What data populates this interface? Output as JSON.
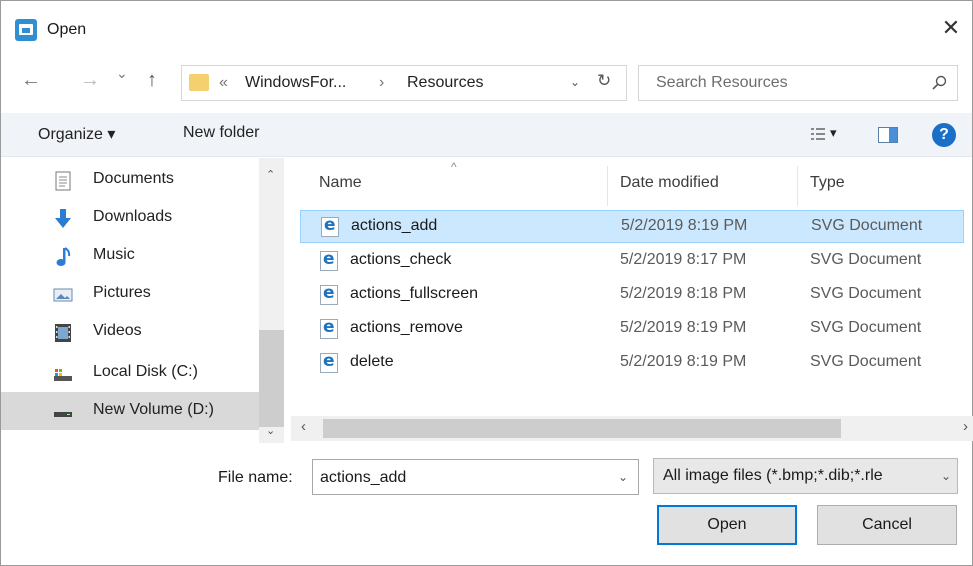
{
  "window": {
    "title": "Open",
    "close_glyph": "✕"
  },
  "nav": {
    "back": "←",
    "forward": "→",
    "recent": "⌄",
    "up": "↑"
  },
  "address": {
    "overflow": "«",
    "crumbs": [
      "WindowsFor...",
      "Resources"
    ],
    "separator": "›",
    "dropdown": "⌄",
    "refresh": "↻"
  },
  "search": {
    "placeholder": "Search Resources"
  },
  "toolbar": {
    "organize": "Organize ▾",
    "new_folder": "New folder",
    "view_chevron": "▾",
    "help": "?"
  },
  "sidebar": {
    "items": [
      {
        "label": "Documents",
        "icon": "documents-icon"
      },
      {
        "label": "Downloads",
        "icon": "downloads-icon"
      },
      {
        "label": "Music",
        "icon": "music-icon"
      },
      {
        "label": "Pictures",
        "icon": "pictures-icon"
      },
      {
        "label": "Videos",
        "icon": "videos-icon"
      },
      {
        "label": "Local Disk (C:)",
        "icon": "local-disk-icon"
      },
      {
        "label": "New Volume (D:)",
        "icon": "drive-icon",
        "selected": true
      }
    ],
    "scroll_up": "⌃",
    "scroll_down": "⌄"
  },
  "files": {
    "columns": {
      "name": "Name",
      "date": "Date modified",
      "type": "Type",
      "sort_indicator": "^"
    },
    "rows": [
      {
        "name": "actions_add",
        "date": "5/2/2019 8:19 PM",
        "type": "SVG Document",
        "selected": true
      },
      {
        "name": "actions_check",
        "date": "5/2/2019 8:17 PM",
        "type": "SVG Document"
      },
      {
        "name": "actions_fullscreen",
        "date": "5/2/2019 8:18 PM",
        "type": "SVG Document"
      },
      {
        "name": "actions_remove",
        "date": "5/2/2019 8:19 PM",
        "type": "SVG Document"
      },
      {
        "name": "delete",
        "date": "5/2/2019 8:19 PM",
        "type": "SVG Document"
      }
    ],
    "scroll_left": "‹",
    "scroll_right": "›"
  },
  "footer": {
    "file_name_label": "File name:",
    "file_name_value": "actions_add",
    "file_name_chevron": "⌄",
    "filter_value": "All image files (*.bmp;*.dib;*.rle",
    "filter_chevron": "⌄",
    "open": "Open",
    "cancel": "Cancel"
  },
  "colors": {
    "selection": "#cce8ff",
    "accent": "#0078d7",
    "help": "#1a6fc9"
  }
}
